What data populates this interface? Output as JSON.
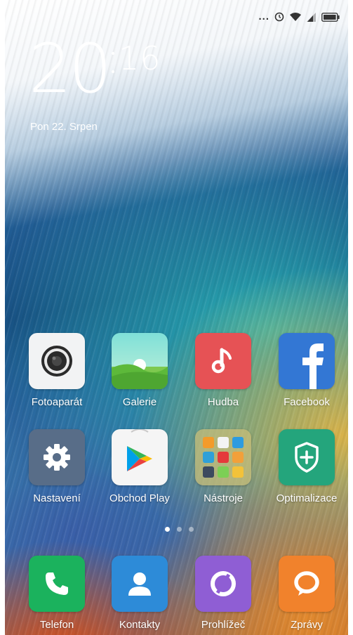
{
  "status_bar": {
    "dots": "..."
  },
  "clock": {
    "hours": "20",
    "minutes": "16"
  },
  "date": "Pon 22. Srpen",
  "apps": {
    "camera": "Fotoaparát",
    "gallery": "Galerie",
    "music": "Hudba",
    "facebook": "Facebook",
    "settings": "Nastavení",
    "play_store": "Obchod Play",
    "tools": "Nástroje",
    "security": "Optimalizace"
  },
  "dock": {
    "phone": "Telefon",
    "contacts": "Kontakty",
    "browser": "Prohlížeč",
    "messages": "Zprávy"
  },
  "pages": {
    "count": 3,
    "active": 1
  },
  "colors": {
    "music": "#e65255",
    "facebook": "#3377d4",
    "settings": "#586d88",
    "security": "#24a57c",
    "phone": "#1bb25d",
    "contacts": "#2d8bd8",
    "browser": "#8f5ed4",
    "messages": "#f1822c"
  }
}
